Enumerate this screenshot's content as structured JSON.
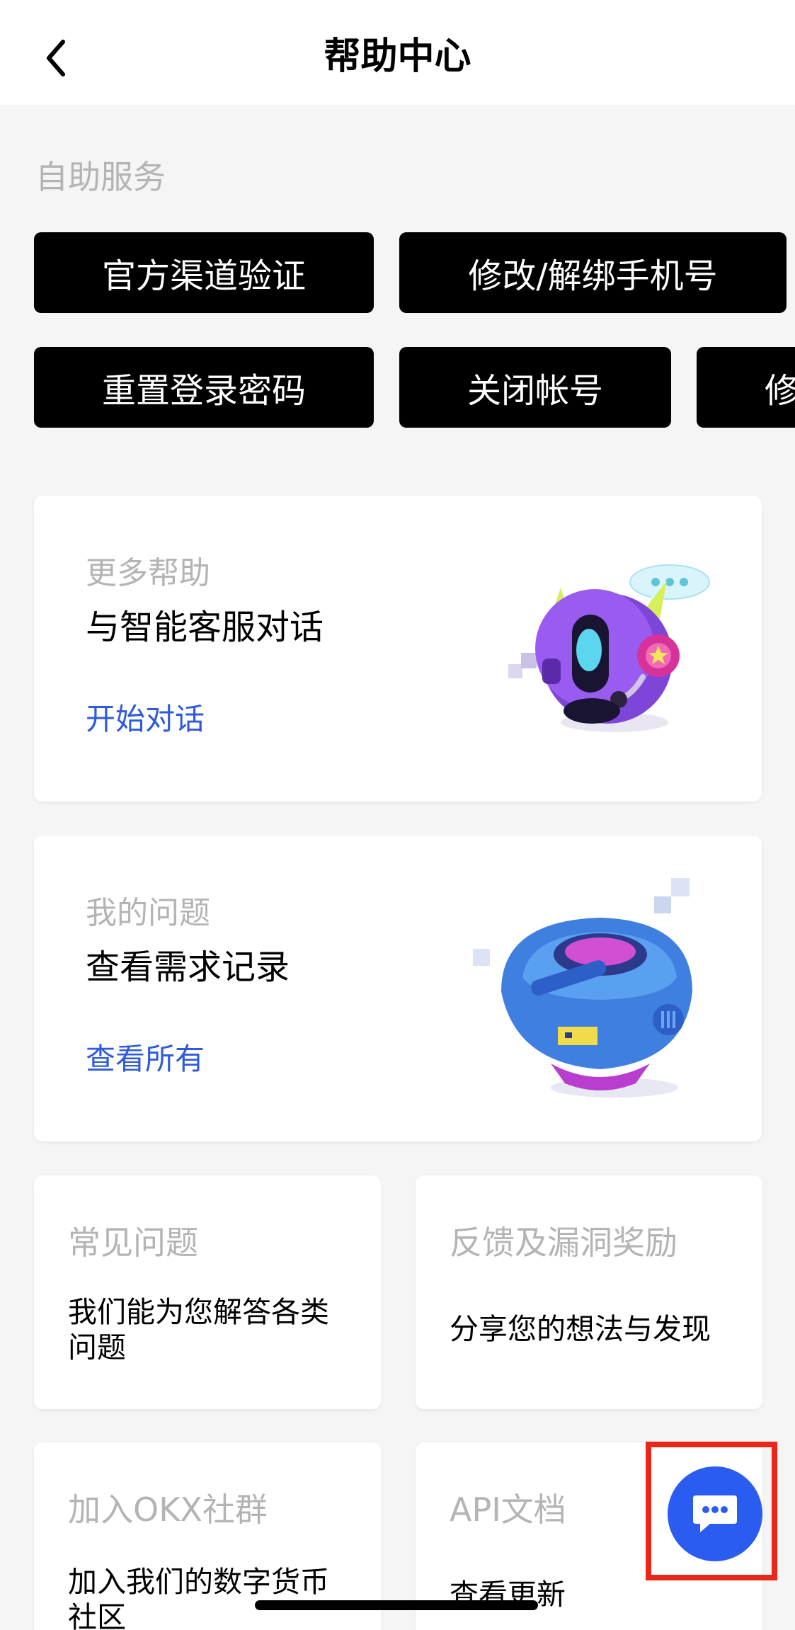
{
  "header": {
    "title": "帮助中心",
    "back_icon": "chevron-left-icon"
  },
  "self_service": {
    "label": "自助服务",
    "row1": [
      {
        "label": "官方渠道验证"
      },
      {
        "label": "修改/解绑手机号"
      }
    ],
    "row2": [
      {
        "label": "重置登录密码"
      },
      {
        "label": "关闭帐号"
      },
      {
        "label": "修"
      }
    ]
  },
  "more_help": {
    "subtitle": "更多帮助",
    "title": "与智能客服对话",
    "link": "开始对话",
    "illustration": "robot-chat-illustration"
  },
  "my_issues": {
    "subtitle": "我的问题",
    "title": "查看需求记录",
    "link": "查看所有",
    "illustration": "robot-pod-illustration"
  },
  "tiles": [
    {
      "title": "常见问题",
      "desc": "我们能为您解答各类问题"
    },
    {
      "title": "反馈及漏洞奖励",
      "desc": "分享您的想法与发现"
    },
    {
      "title": "加入OKX社群",
      "desc": "加入我们的数字货币社区"
    },
    {
      "title": "API文档",
      "desc": "查看更新"
    }
  ],
  "chat_fab": {
    "icon": "chat-bubble-icon"
  },
  "colors": {
    "background": "#f5f5f5",
    "button_black": "#000000",
    "link_blue": "#2f5bdb",
    "fab_blue": "#2b5cf0",
    "highlight_red": "#e8261a"
  }
}
